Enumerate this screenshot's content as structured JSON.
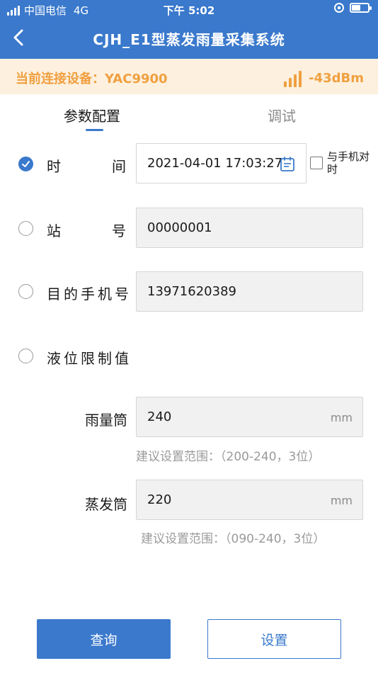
{
  "status_bar": {
    "carrier": "中国电信",
    "network": "4G",
    "time": "下午 5:02"
  },
  "nav": {
    "title": "CJH_E1型蒸发雨量采集系统"
  },
  "device_bar": {
    "label": "当前连接设备：YAC9900",
    "rssi": "-43dBm"
  },
  "tabs": [
    {
      "label": "参数配置",
      "active": true
    },
    {
      "label": "调试",
      "active": false
    }
  ],
  "form": {
    "time": {
      "label_a": "时",
      "label_b": "间",
      "value": "2021-04-01 17:03:27",
      "checked": true,
      "sync_label": "与手机对时"
    },
    "station": {
      "label_a": "站",
      "label_b": "号",
      "value": "00000001",
      "checked": false
    },
    "phone": {
      "label": "目的手机号",
      "value": "13971620389",
      "checked": false
    },
    "level_limit": {
      "label": "液位限制值",
      "checked": false,
      "rain_gauge": {
        "label": "雨量筒",
        "value": "240",
        "unit": "mm",
        "hint": "建议设置范围：（200-240，3位）"
      },
      "evaporation": {
        "label": "蒸发筒",
        "value": "220",
        "unit": "mm",
        "hint": "建议设置范围：（090-240，3位）"
      }
    }
  },
  "buttons": {
    "query": "查询",
    "set": "设置"
  },
  "colors": {
    "primary": "#3a79cc",
    "device_bar_bg": "#fdf0de",
    "device_bar_text": "#f0a040",
    "field_bg": "#f1f1f1"
  }
}
